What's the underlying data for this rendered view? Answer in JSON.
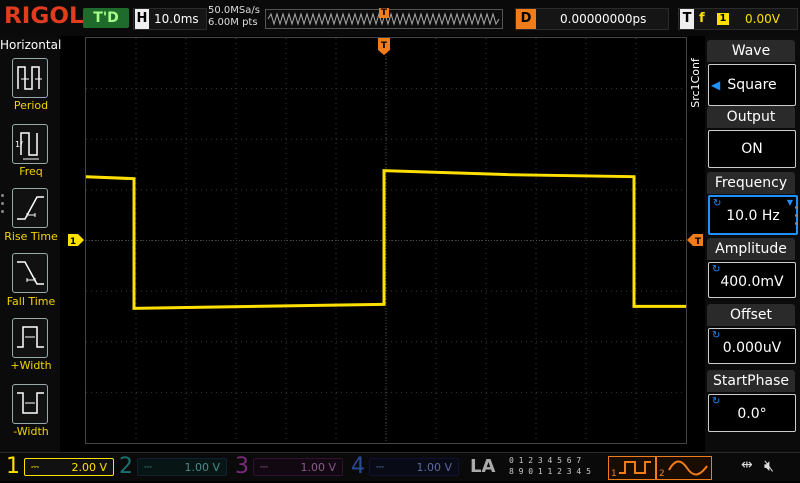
{
  "brand": "RIGOL",
  "top": {
    "status": "T'D",
    "horizontal_tag": "H",
    "timebase": "10.0ms",
    "sample_rate": "50.0MSa/s",
    "memory_depth": "6.00M pts",
    "trigger_marker": "T",
    "delay_tag": "D",
    "delay": "0.00000000ps",
    "trigger_tag": "T",
    "trigger_edge": "f",
    "trigger_source": "1",
    "trigger_level": "0.00V"
  },
  "left_panel": {
    "title": "Horizontal",
    "items": [
      {
        "label": "Period"
      },
      {
        "label": "Freq"
      },
      {
        "label": "Rise Time"
      },
      {
        "label": "Fall Time"
      },
      {
        "label": "+Width"
      },
      {
        "label": "-Width"
      }
    ]
  },
  "screen": {
    "trigger_top_marker": "T",
    "ch1_marker": "1",
    "trigger_level_marker": "T"
  },
  "right_panel": {
    "source_label": "Src1Conf",
    "wave_title": "Wave",
    "wave_value": "Square",
    "output_title": "Output",
    "output_value": "ON",
    "frequency_title": "Frequency",
    "frequency_value": "10.0 Hz",
    "amplitude_title": "Amplitude",
    "amplitude_value": "400.0mV",
    "offset_title": "Offset",
    "offset_value": "0.000uV",
    "startphase_title": "StartPhase",
    "startphase_value": "0.0°"
  },
  "bottom": {
    "channels": [
      {
        "num": "1",
        "scale": "2.00 V",
        "color": "#ffe000"
      },
      {
        "num": "2",
        "scale": "1.00 V",
        "color": "#1fb3b3"
      },
      {
        "num": "3",
        "scale": "1.00 V",
        "color": "#d040d0"
      },
      {
        "num": "4",
        "scale": "1.00 V",
        "color": "#3b6fe0"
      }
    ],
    "la_label": "LA",
    "la_bits_row1": "0 1 2 3   4 5 6 7",
    "la_bits_row2": "8 9 0 1   1 2 3 4 5",
    "src1_num": "1",
    "src2_num": "2"
  },
  "colors": {
    "ch1": "#ffe000",
    "accent": "#f07c1a",
    "select": "#1e90ff"
  },
  "waveform": {
    "high_value_div": 1.3,
    "low_value_div": -1.3
  }
}
